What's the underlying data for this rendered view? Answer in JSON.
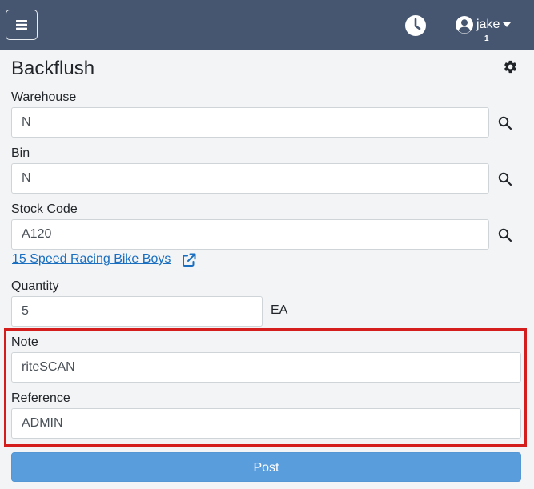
{
  "header": {
    "username": "jake",
    "user_badge": "1",
    "icons": {
      "menu": "hamburger-icon",
      "history": "clock-icon",
      "user": "user-circle-icon",
      "caret": "caret-down-icon"
    }
  },
  "page": {
    "title": "Backflush",
    "settings_icon": "gear-icon"
  },
  "form": {
    "warehouse": {
      "label": "Warehouse",
      "value": "N"
    },
    "bin": {
      "label": "Bin",
      "value": "N"
    },
    "stock_code": {
      "label": "Stock Code",
      "value": "A120",
      "description": "15 Speed Racing Bike Boys"
    },
    "quantity": {
      "label": "Quantity",
      "value": "5",
      "uom": "EA"
    },
    "note": {
      "label": "Note",
      "value": "riteSCAN"
    },
    "reference": {
      "label": "Reference",
      "value": "ADMIN"
    },
    "post_label": "Post"
  },
  "colors": {
    "navbar": "#465670",
    "accent_button": "#5a9ddc",
    "link": "#1a6fc0",
    "highlight": "#d41e1e"
  }
}
